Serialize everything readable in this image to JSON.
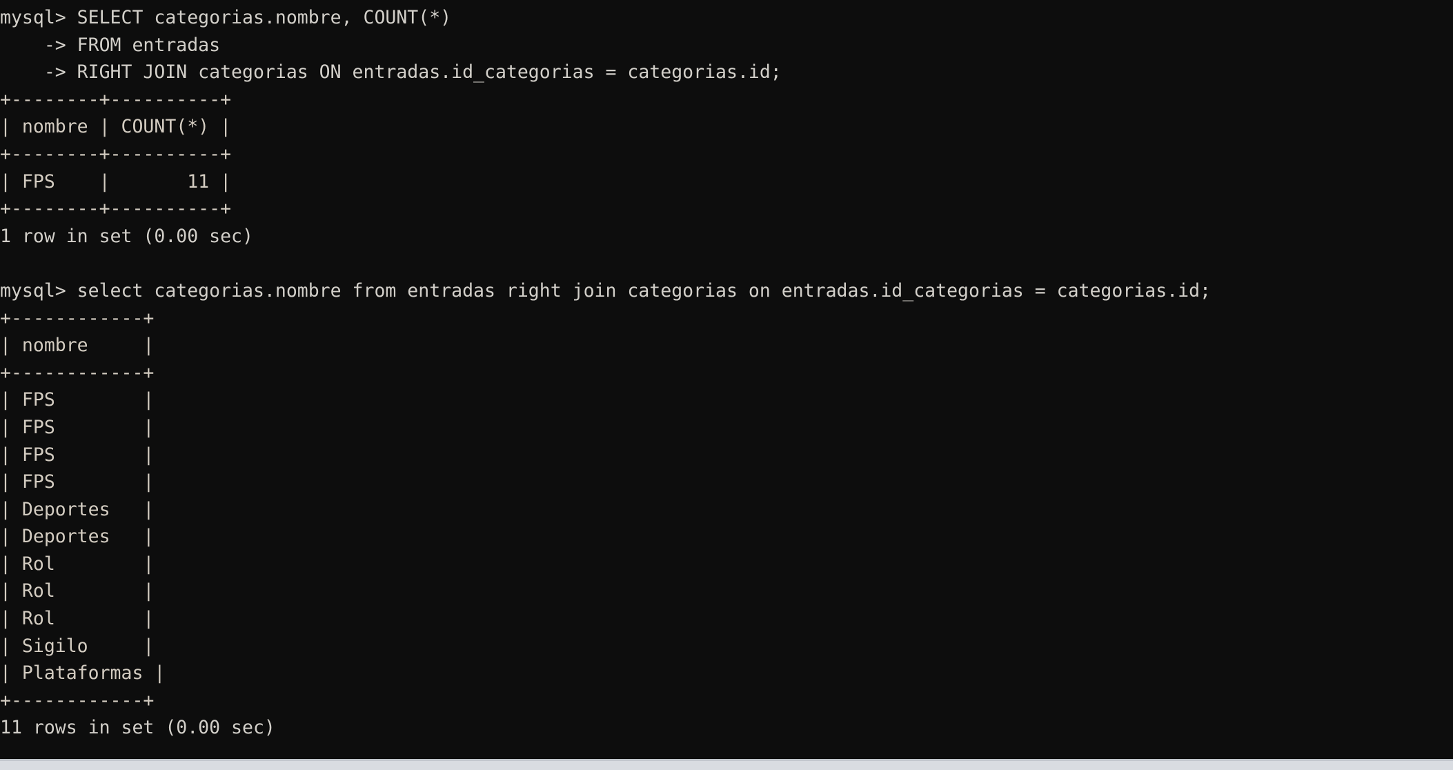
{
  "terminal": {
    "prompt": "mysql>",
    "continuation_prompt": "    ->",
    "background_color": "#0d0d0d",
    "text_color": "#d2cfc9",
    "frame_color": "#d3ccc1",
    "font_size_px": 26.5,
    "lines": [
      {
        "id": "l01",
        "kind": "command",
        "text": "mysql> SELECT categorias.nombre, COUNT(*)"
      },
      {
        "id": "l02",
        "kind": "command",
        "text": "    -> FROM entradas"
      },
      {
        "id": "l03",
        "kind": "command",
        "text": "    -> RIGHT JOIN categorias ON entradas.id_categorias = categorias.id;"
      },
      {
        "id": "l04",
        "kind": "frame",
        "text": "+--------+----------+"
      },
      {
        "id": "l05",
        "kind": "frame",
        "text": "| nombre | COUNT(*) |"
      },
      {
        "id": "l06",
        "kind": "frame",
        "text": "+--------+----------+"
      },
      {
        "id": "l07",
        "kind": "frame",
        "text": "| FPS    |       11 |"
      },
      {
        "id": "l08",
        "kind": "frame",
        "text": "+--------+----------+"
      },
      {
        "id": "l09",
        "kind": "status",
        "text": "1 row in set (0.00 sec)"
      },
      {
        "id": "l10",
        "kind": "blank",
        "text": " "
      },
      {
        "id": "l11",
        "kind": "command",
        "text": "mysql> select categorias.nombre from entradas right join categorias on entradas.id_categorias = categorias.id;"
      },
      {
        "id": "l12",
        "kind": "frame",
        "text": "+------------+"
      },
      {
        "id": "l13",
        "kind": "frame",
        "text": "| nombre     |"
      },
      {
        "id": "l14",
        "kind": "frame",
        "text": "+------------+"
      },
      {
        "id": "l15",
        "kind": "frame",
        "text": "| FPS        |"
      },
      {
        "id": "l16",
        "kind": "frame",
        "text": "| FPS        |"
      },
      {
        "id": "l17",
        "kind": "frame",
        "text": "| FPS        |"
      },
      {
        "id": "l18",
        "kind": "frame",
        "text": "| FPS        |"
      },
      {
        "id": "l19",
        "kind": "frame",
        "text": "| Deportes   |"
      },
      {
        "id": "l20",
        "kind": "frame",
        "text": "| Deportes   |"
      },
      {
        "id": "l21",
        "kind": "frame",
        "text": "| Rol        |"
      },
      {
        "id": "l22",
        "kind": "frame",
        "text": "| Rol        |"
      },
      {
        "id": "l23",
        "kind": "frame",
        "text": "| Rol        |"
      },
      {
        "id": "l24",
        "kind": "frame",
        "text": "| Sigilo     |"
      },
      {
        "id": "l25",
        "kind": "frame",
        "text": "| Plataformas |"
      },
      {
        "id": "l26",
        "kind": "frame",
        "text": "+------------+"
      },
      {
        "id": "l27",
        "kind": "status",
        "text": "11 rows in set (0.00 sec)"
      }
    ],
    "queries": [
      {
        "sql": "SELECT categorias.nombre, COUNT(*) FROM entradas RIGHT JOIN categorias ON entradas.id_categorias = categorias.id;",
        "result_columns": [
          "nombre",
          "COUNT(*)"
        ],
        "result_rows": [
          [
            "FPS",
            "11"
          ]
        ],
        "result_status": "1 row in set (0.00 sec)"
      },
      {
        "sql": "select categorias.nombre from entradas right join categorias on entradas.id_categorias = categorias.id;",
        "result_columns": [
          "nombre"
        ],
        "result_rows": [
          [
            "FPS"
          ],
          [
            "FPS"
          ],
          [
            "FPS"
          ],
          [
            "FPS"
          ],
          [
            "Deportes"
          ],
          [
            "Deportes"
          ],
          [
            "Rol"
          ],
          [
            "Rol"
          ],
          [
            "Rol"
          ],
          [
            "Sigilo"
          ],
          [
            "Plataformas"
          ]
        ],
        "result_status": "11 rows in set (0.00 sec)"
      }
    ]
  }
}
